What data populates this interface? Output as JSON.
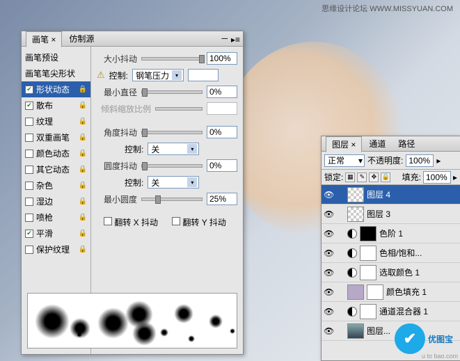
{
  "watermark_top": "思缘设计论坛  WWW.MISSYUAN.COM",
  "watermark_bot": "优图宝",
  "watermark_url": "u to bao.com",
  "brush_panel": {
    "tabs": [
      "画笔",
      "仿制源"
    ],
    "sidebar": [
      {
        "label": "画笔预设",
        "type": "header"
      },
      {
        "label": "画笔笔尖形状",
        "type": "plain"
      },
      {
        "label": "形状动态",
        "checked": true,
        "selected": true,
        "lock": true
      },
      {
        "label": "散布",
        "checked": true,
        "lock": true
      },
      {
        "label": "纹理",
        "checked": false,
        "lock": true
      },
      {
        "label": "双重画笔",
        "checked": false,
        "lock": true
      },
      {
        "label": "颜色动态",
        "checked": false,
        "lock": true
      },
      {
        "label": "其它动态",
        "checked": false,
        "lock": true
      },
      {
        "label": "杂色",
        "checked": false,
        "lock": true
      },
      {
        "label": "湿边",
        "checked": false,
        "lock": true
      },
      {
        "label": "喷枪",
        "checked": false,
        "lock": true
      },
      {
        "label": "平滑",
        "checked": true,
        "lock": true
      },
      {
        "label": "保护纹理",
        "checked": false,
        "lock": true
      }
    ],
    "controls": {
      "size_jitter_lbl": "大小抖动",
      "size_jitter_val": "100%",
      "control_lbl": "控制:",
      "control1_val": "钢笔压力",
      "min_diam_lbl": "最小直径",
      "min_diam_val": "0%",
      "tilt_lbl": "倾斜缩放比例",
      "tilt_val": "",
      "angle_jitter_lbl": "角度抖动",
      "angle_jitter_val": "0%",
      "control2_val": "关",
      "round_jitter_lbl": "圆度抖动",
      "round_jitter_val": "0%",
      "control3_val": "关",
      "min_round_lbl": "最小圆度",
      "min_round_val": "25%",
      "flipx": "翻转 X 抖动",
      "flipy": "翻转 Y 抖动"
    }
  },
  "layers_panel": {
    "tabs": [
      "图层",
      "通道",
      "路径"
    ],
    "blend": "正常",
    "opacity_lbl": "不透明度:",
    "opacity_val": "100%",
    "lock_lbl": "锁定:",
    "fill_lbl": "填充:",
    "fill_val": "100%",
    "layers": [
      {
        "name": "图层 4",
        "thumb": "checker",
        "sel": true
      },
      {
        "name": "图层 3",
        "thumb": "checker"
      },
      {
        "name": "色阶 1",
        "adj": true,
        "mask": "black"
      },
      {
        "name": "色相/饱和...",
        "adj": true,
        "mask": "white"
      },
      {
        "name": "选取颜色 1",
        "adj": true,
        "mask": "white"
      },
      {
        "name": "颜色填充 1",
        "adj": true,
        "mask": "white",
        "fillc": "#b8a8c8"
      },
      {
        "name": "通道混合器 1",
        "adj": true,
        "mask": "white"
      },
      {
        "name": "图层...",
        "thumb": "img"
      }
    ]
  }
}
